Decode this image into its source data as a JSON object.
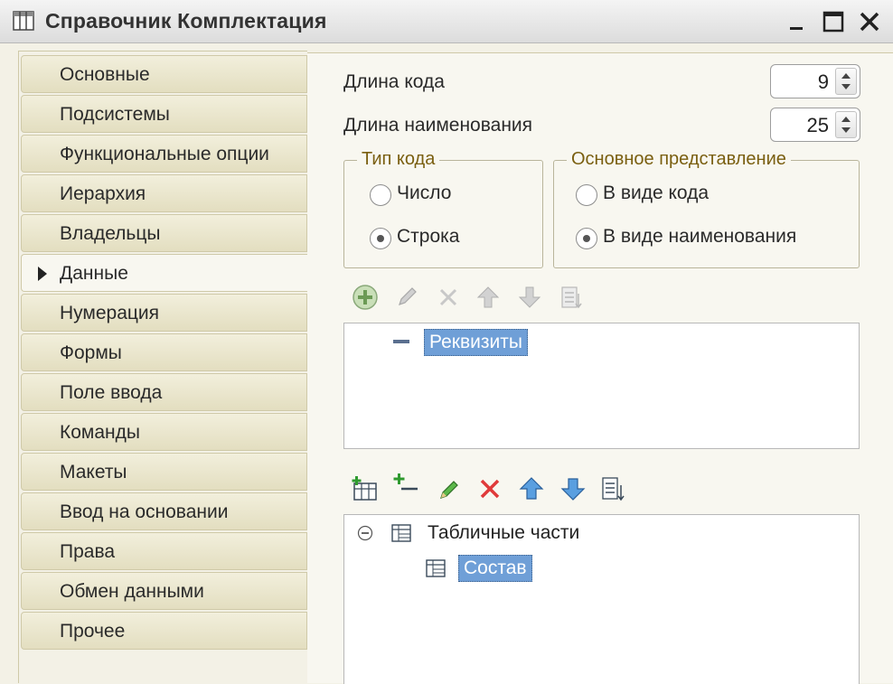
{
  "window": {
    "title": "Справочник Комплектация"
  },
  "nav": {
    "items": [
      {
        "label": "Основные"
      },
      {
        "label": "Подсистемы"
      },
      {
        "label": "Функциональные опции"
      },
      {
        "label": "Иерархия"
      },
      {
        "label": "Владельцы"
      },
      {
        "label": "Данные",
        "active": true
      },
      {
        "label": "Нумерация"
      },
      {
        "label": "Формы"
      },
      {
        "label": "Поле ввода"
      },
      {
        "label": "Команды"
      },
      {
        "label": "Макеты"
      },
      {
        "label": "Ввод на основании"
      },
      {
        "label": "Права"
      },
      {
        "label": "Обмен данными"
      },
      {
        "label": "Прочее"
      }
    ]
  },
  "data": {
    "code_length_label": "Длина кода",
    "code_length_value": "9",
    "name_length_label": "Длина наименования",
    "name_length_value": "25",
    "code_type": {
      "legend": "Тип кода",
      "options": [
        "Число",
        "Строка"
      ],
      "selected": "Строка"
    },
    "main_presentation": {
      "legend": "Основное представление",
      "options": [
        "В виде кода",
        "В виде наименования"
      ],
      "selected": "В виде наименования"
    },
    "attributes_tree": {
      "root_label": "Реквизиты"
    },
    "tabular_tree": {
      "root_label": "Табличные части",
      "child_label": "Состав"
    }
  },
  "colors": {
    "accent_selection": "#6f9fd7",
    "legend_text": "#7a5f10",
    "nav_bg": "#e8e4c9"
  }
}
